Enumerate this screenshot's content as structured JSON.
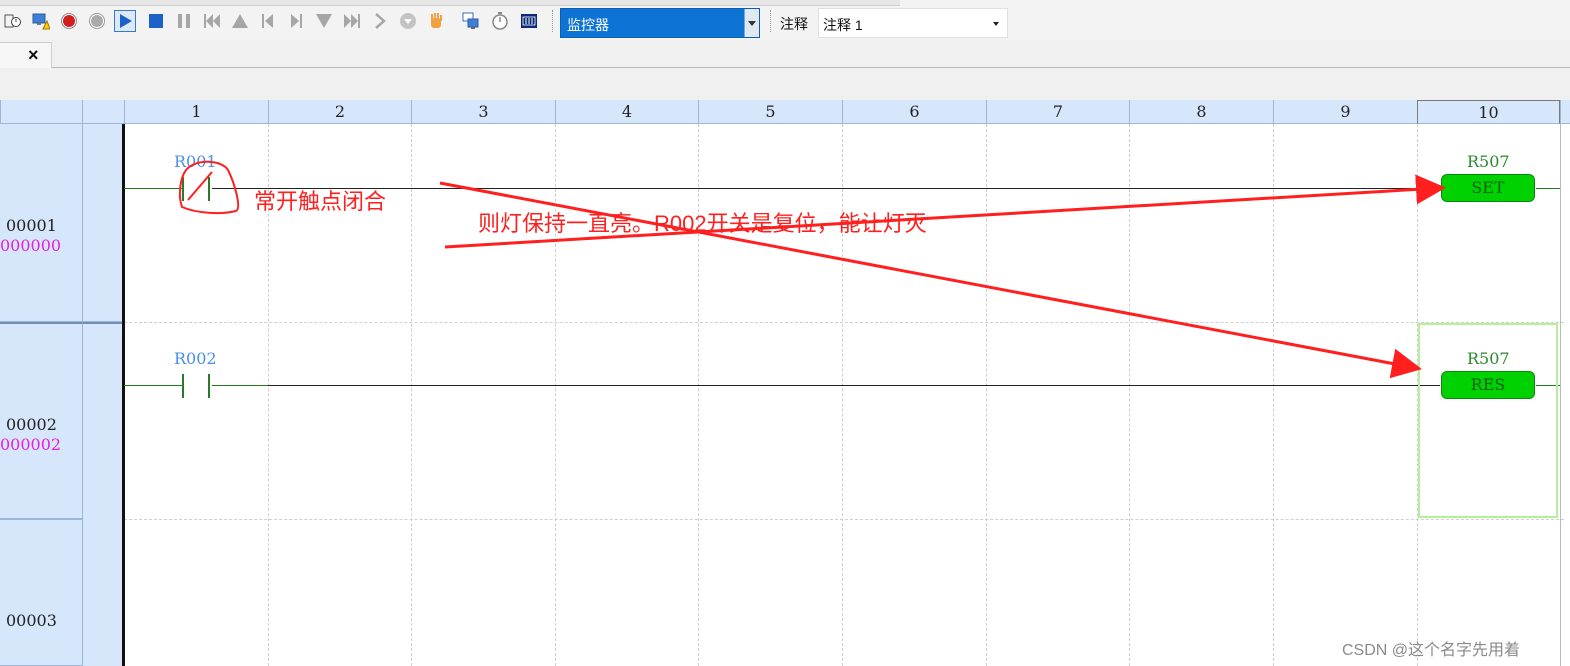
{
  "toolbar": {
    "icons": [
      "timer-icon",
      "monitor-warning-icon",
      "record-icon",
      "stop-record-icon",
      "play-icon",
      "stop-icon",
      "pause-icon",
      "skip-start-icon",
      "step-up-icon",
      "step-back-icon",
      "step-forward-icon",
      "step-down-icon",
      "skip-end-icon",
      "next-icon",
      "down-circle-icon",
      "hand-icon",
      "network-monitor-icon",
      "stopwatch-icon",
      "clock-display-icon"
    ],
    "monitor_select": "监控器",
    "comment_label": "注释",
    "comment_select": "注释 1"
  },
  "tab": {
    "close": "×"
  },
  "ladder": {
    "columns": [
      "1",
      "2",
      "3",
      "4",
      "5",
      "6",
      "7",
      "8",
      "9",
      "10"
    ],
    "rows": [
      {
        "num": "00001",
        "step": "000000",
        "contact": "R001",
        "coil": "R507",
        "coil_type": "SET"
      },
      {
        "num": "00002",
        "step": "000002",
        "contact": "R002",
        "coil": "R507",
        "coil_type": "RES"
      },
      {
        "num": "00003",
        "step": ""
      }
    ]
  },
  "annotations": {
    "note1": "常开触点闭合",
    "note2": "则灯保持一直亮。R002开关是复位，能让灯灭"
  },
  "watermark": "CSDN @这个名字先用着",
  "colors": {
    "accent_blue": "#0d73d4",
    "coil_green": "#00d100",
    "annotation_red": "#ff1f1f",
    "header_blue": "#d6e6fb"
  }
}
